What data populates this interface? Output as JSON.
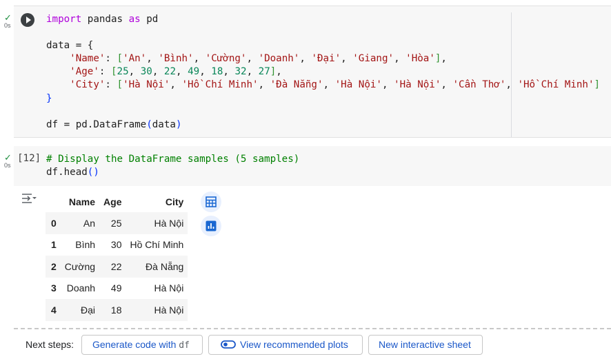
{
  "cell1": {
    "status_check": "✓",
    "duration": "0s",
    "code": {
      "line1": [
        "import",
        " pandas ",
        "as",
        " pd"
      ],
      "line3": "data = {",
      "name_key": "'Name'",
      "names": [
        "'An'",
        "'Bình'",
        "'Cường'",
        "'Doanh'",
        "'Đại'",
        "'Giang'",
        "'Hòa'"
      ],
      "age_key": "'Age'",
      "ages": [
        "25",
        "30",
        "22",
        "49",
        "18",
        "32",
        "27"
      ],
      "city_key": "'City'",
      "cities": [
        "'Hà Nội'",
        "'Hồ Chí Minh'",
        "'Đà Nẵng'",
        "'Hà Nội'",
        "'Hà Nội'",
        "'Cần Thơ'",
        "'Hồ Chí Minh'"
      ],
      "close_brace": "}",
      "last_line_prefix": "df = pd.DataFrame",
      "last_line_arg": "data"
    }
  },
  "cell2": {
    "status_check": "✓",
    "duration": "0s",
    "exec_count": "[12]",
    "comment": "# Display the DataFrame samples (5 samples)",
    "call": "df.head",
    "parens": "()"
  },
  "output": {
    "columns": [
      "",
      "Name",
      "Age",
      "City"
    ],
    "rows": [
      [
        "0",
        "An",
        "25",
        "Hà Nội"
      ],
      [
        "1",
        "Bình",
        "30",
        "Hồ Chí Minh"
      ],
      [
        "2",
        "Cường",
        "22",
        "Đà Nẵng"
      ],
      [
        "3",
        "Doanh",
        "49",
        "Hà Nội"
      ],
      [
        "4",
        "Đại",
        "18",
        "Hà Nội"
      ]
    ],
    "icons": [
      "output-toggle-icon",
      "table-view-icon",
      "chart-icon"
    ]
  },
  "next_steps": {
    "label": "Next steps:",
    "generate_prefix": "Generate code with ",
    "generate_code": "df",
    "view_plots": "View recommended plots",
    "new_sheet": "New interactive sheet"
  },
  "colors": {
    "keyword": "#af00db",
    "string": "#a31515",
    "number": "#098658",
    "comment": "#008000",
    "link": "#1a57c8",
    "check": "#1e8e3e"
  }
}
